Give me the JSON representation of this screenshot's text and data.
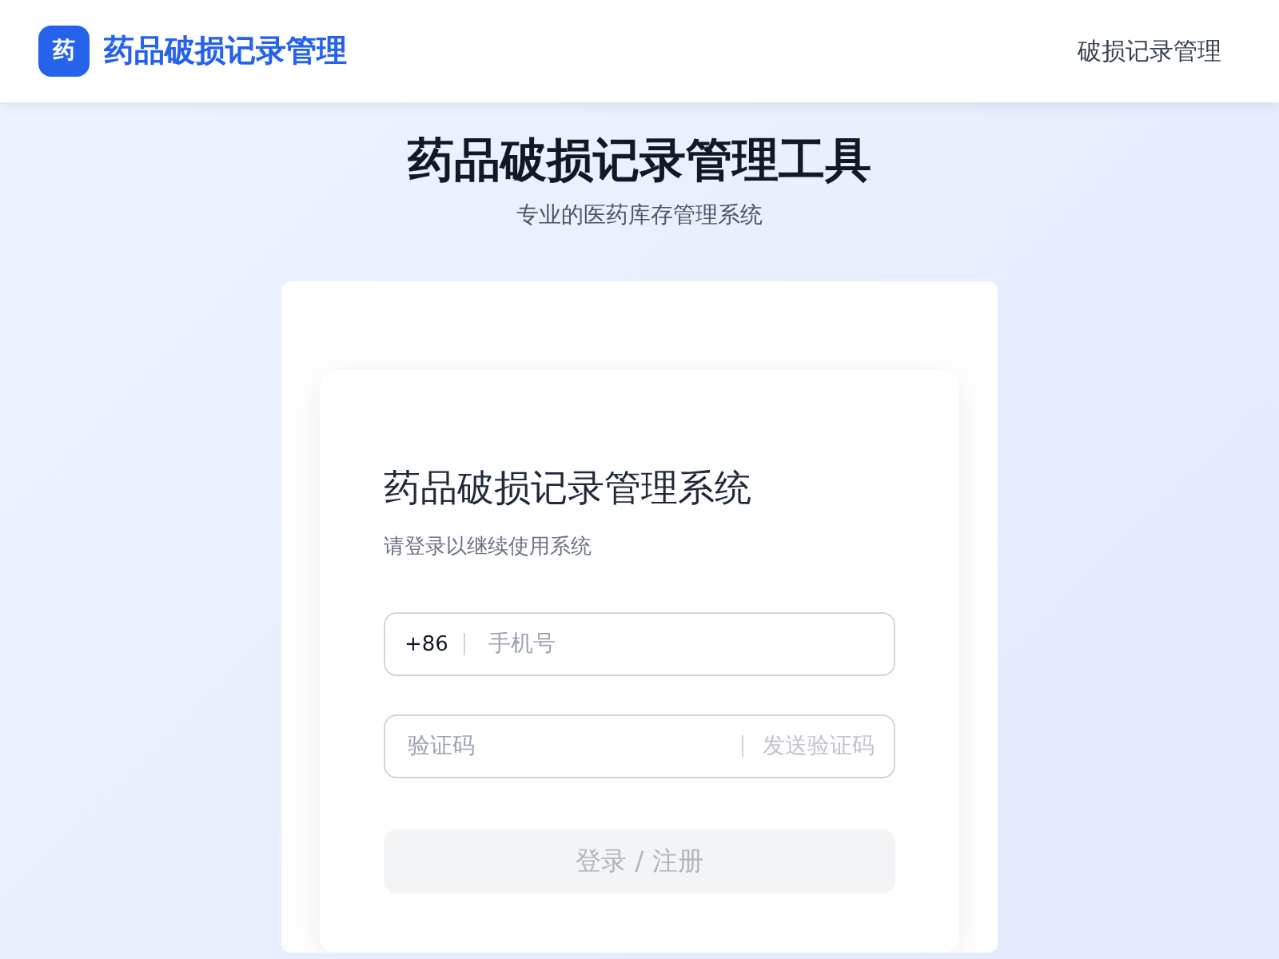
{
  "header": {
    "logo_text": "药",
    "brand": "药品破损记录管理",
    "nav_link": "破损记录管理"
  },
  "hero": {
    "title": "药品破损记录管理工具",
    "subtitle": "专业的医药库存管理系统"
  },
  "login": {
    "title": "药品破损记录管理系统",
    "subtitle": "请登录以继续使用系统",
    "phone": {
      "prefix": "+86",
      "placeholder": "手机号"
    },
    "code": {
      "placeholder": "验证码",
      "send_button": {
        "label": "发送验证码",
        "disabled": true
      }
    },
    "submit": {
      "label": "登录 / 注册",
      "disabled": true
    }
  }
}
